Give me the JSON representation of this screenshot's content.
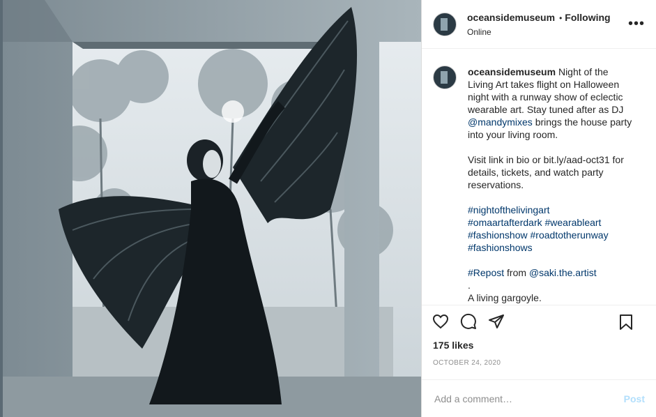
{
  "header": {
    "username": "oceansidemuseum",
    "separator": "•",
    "follow_label": "Following",
    "status": "Online",
    "more_label": "•••"
  },
  "caption": {
    "username": "oceansidemuseum",
    "text_1a": "Night of the Living Art takes flight on Halloween night with a runway show of eclectic wearable art. Stay tuned after as DJ",
    "mention_1": "@mandymixes",
    "text_1b": "brings the house party into your living room.",
    "text_2": "Visit link in bio or bit.ly/aad-oct31 for details, tickets, and watch party reservations.",
    "hashtags": [
      "#nightofthelivingart",
      "#omaartafterdark",
      "#wearableart",
      "#fashionshow",
      "#roadtotherunway",
      "#fashionshows"
    ],
    "repost_tag": "#Repost",
    "repost_from": "from",
    "repost_user": "@saki.the.artist",
    "dot_line": ".",
    "closing": "A living gargoyle."
  },
  "actions": {
    "icons": [
      "heart-icon",
      "comment-icon",
      "share-icon",
      "bookmark-icon"
    ]
  },
  "likes": "175 likes",
  "date": "OCTOBER 24, 2020",
  "comment": {
    "placeholder": "Add a comment…",
    "post_label": "Post"
  },
  "colors": {
    "link": "#00376b",
    "post_disabled": "#b2dffc",
    "muted": "#8e8e8e"
  }
}
